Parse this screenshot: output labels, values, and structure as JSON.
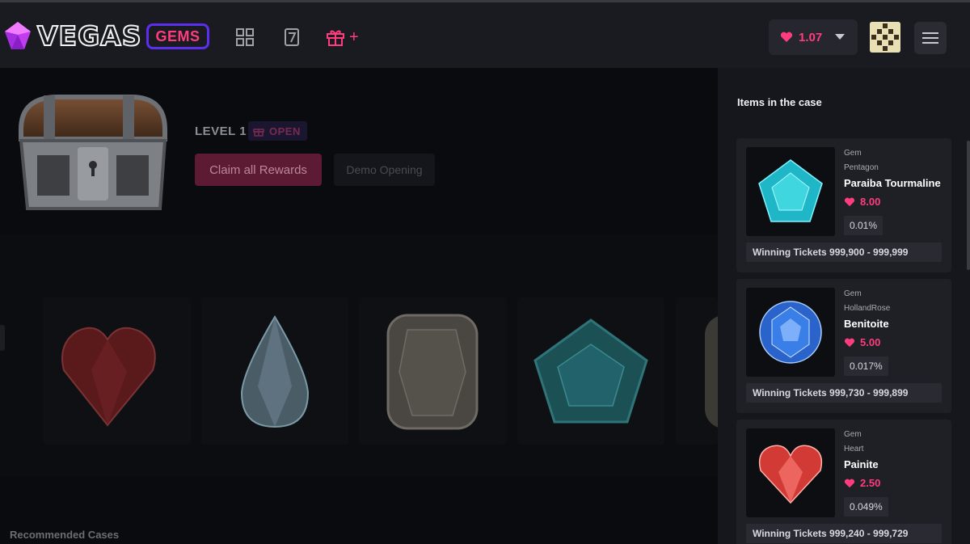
{
  "header": {
    "logo_text": "VEGAS",
    "logo_badge": "GEMS",
    "gift_plus": "+",
    "balance": "1.07",
    "icons": [
      "grid-icon",
      "dice-seven-icon",
      "gift-icon",
      "heart-icon",
      "chevron-down-icon",
      "hamburger-menu-icon"
    ]
  },
  "case": {
    "level": "LEVEL 1",
    "open_badge": "OPEN",
    "claim_button": "Claim all Rewards",
    "demo_button": "Demo Opening"
  },
  "reel": {
    "gems": [
      "heart",
      "pear",
      "cushion",
      "pentagon",
      "partial"
    ]
  },
  "footer": {
    "recommended": "Recommended Cases"
  },
  "panel": {
    "title": "Items in the case",
    "items": [
      {
        "category": "Gem",
        "shape": "Pentagon",
        "name": "Paraiba Tourmaline",
        "price": "8.00",
        "chance": "0.01%",
        "tickets": "Winning Tickets 999,900 - 999,999",
        "color": "#3fd6e0"
      },
      {
        "category": "Gem",
        "shape": "HollandRose",
        "name": "Benitoite",
        "price": "5.00",
        "chance": "0.017%",
        "tickets": "Winning Tickets 999,730 - 999,899",
        "color": "#3a7fe8"
      },
      {
        "category": "Gem",
        "shape": "Heart",
        "name": "Painite",
        "price": "2.50",
        "chance": "0.049%",
        "tickets": "Winning Tickets 999,240 - 999,729",
        "color": "#e8504a"
      }
    ]
  },
  "colors": {
    "accent": "#ff3c7d",
    "logo_outline": "#5b2ef0",
    "background": "#0a0b0e",
    "panel": "#16171c"
  }
}
